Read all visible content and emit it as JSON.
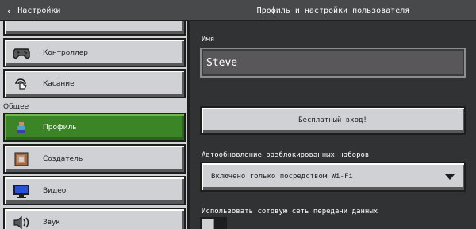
{
  "header": {
    "back_label": "Настройки",
    "title": "Профиль и настройки пользователя"
  },
  "sidebar": {
    "section_label": "Общее",
    "items": [
      {
        "label": "",
        "icon": "unknown-icon"
      },
      {
        "label": "Контроллер",
        "icon": "gamepad-icon"
      },
      {
        "label": "Касание",
        "icon": "touch-icon"
      },
      {
        "label": "Профиль",
        "icon": "profile-icon",
        "active": true
      },
      {
        "label": "Создатель",
        "icon": "creator-icon"
      },
      {
        "label": "Видео",
        "icon": "monitor-icon"
      },
      {
        "label": "Звук",
        "icon": "speaker-icon"
      }
    ]
  },
  "profile": {
    "name_label": "Имя",
    "name_value": "Steve",
    "login_button": "Бесплатный вход!",
    "autoupdate_label": "Автообновление разблокированных наборов",
    "autoupdate_value": "Включено только посредством Wi-Fi",
    "cellular_label": "Использовать сотовую сеть передачи данных",
    "cellular_enabled": false
  },
  "colors": {
    "accent_green": "#3c8527",
    "panel_gray": "#d0d1d4",
    "dark_bg": "#313233"
  }
}
